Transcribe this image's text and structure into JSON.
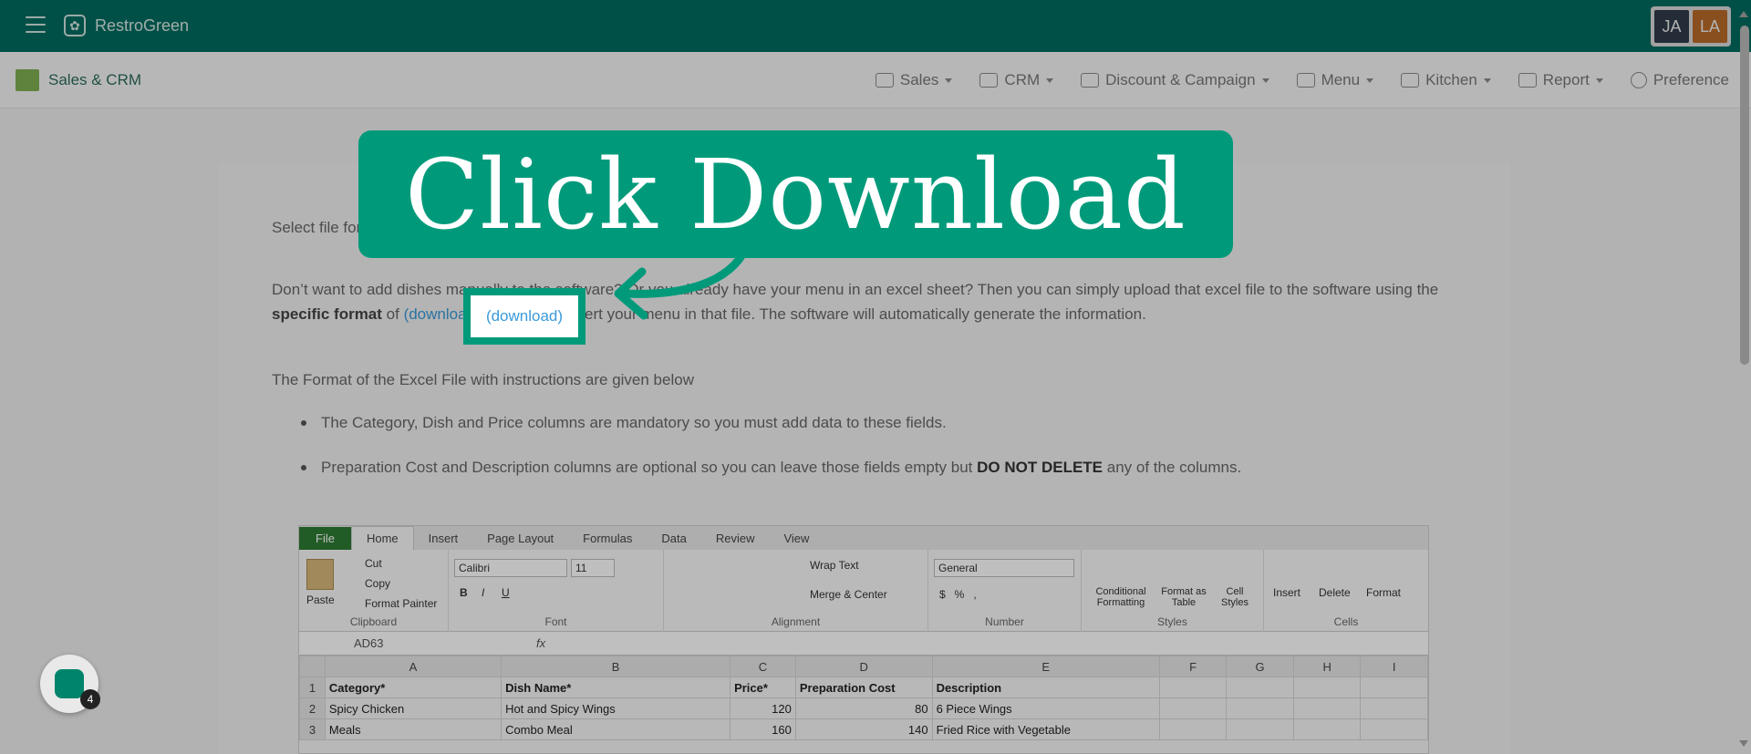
{
  "topbar": {
    "brand": "RestroGreen",
    "avatars": [
      {
        "initials": "JA",
        "color": "#2f3b4a"
      },
      {
        "initials": "LA",
        "color": "#b86a28"
      }
    ]
  },
  "navbar": {
    "module": "Sales & CRM",
    "items": [
      {
        "label": "Sales",
        "icon": "register-icon"
      },
      {
        "label": "CRM",
        "icon": "users-icon"
      },
      {
        "label": "Discount & Campaign",
        "icon": "megaphone-icon"
      },
      {
        "label": "Menu",
        "icon": "menu-list-icon"
      },
      {
        "label": "Kitchen",
        "icon": "chef-hat-icon"
      },
      {
        "label": "Report",
        "icon": "report-icon"
      },
      {
        "label": "Preference",
        "icon": "gear-icon"
      }
    ]
  },
  "content": {
    "para1": "Select file for",
    "para2_part1": "Don’t want to add dishes manually to the software? Or you already have your menu in an excel sheet? Then you can simply upload that excel file to the software using the ",
    "para2_bold": "specific format",
    "para2_part2": " of ",
    "para2_link": "(download)",
    "para2_part3": " the file and insert your menu in that file. The software will automatically generate the information.",
    "para3": "The Format of the Excel File with instructions are given below",
    "bullet1": "The Category, Dish and Price columns are mandatory so you must add data to these fields.",
    "bullet2_part1": "Preparation Cost and Description columns are optional so you can leave those fields empty but ",
    "bullet2_bold": "DO NOT DELETE",
    "bullet2_part2": " any of the columns."
  },
  "callout": {
    "text": "Click Download",
    "color": "#009a7b"
  },
  "download_link": "(download)",
  "excel": {
    "tabs": [
      "File",
      "Home",
      "Insert",
      "Page Layout",
      "Formulas",
      "Data",
      "Review",
      "View"
    ],
    "clipboard": {
      "paste": "Paste",
      "cut": "Cut",
      "copy": "Copy",
      "format_painter": "Format Painter",
      "label": "Clipboard"
    },
    "font": {
      "name": "Calibri",
      "size": "11",
      "label": "Font"
    },
    "alignment": {
      "wrap": "Wrap Text",
      "merge": "Merge & Center",
      "label": "Alignment"
    },
    "number": {
      "format": "General",
      "label": "Number"
    },
    "styles": {
      "cond": "Conditional Formatting",
      "table": "Format as Table",
      "cell": "Cell Styles",
      "label": "Styles"
    },
    "cells": {
      "insert": "Insert",
      "delete": "Delete",
      "format": "Format",
      "label": "Cells"
    },
    "name_box": "AD63",
    "fx": "fx",
    "columns": [
      "A",
      "B",
      "C",
      "D",
      "E",
      "F",
      "G",
      "H",
      "I"
    ],
    "rows": [
      {
        "n": "1",
        "a": "Category*",
        "b": "Dish Name*",
        "c": "Price*",
        "d": "Preparation Cost",
        "e": "Description",
        "header": true
      },
      {
        "n": "2",
        "a": "Spicy Chicken",
        "b": "Hot and Spicy Wings",
        "c": "120",
        "d": "80",
        "e": "6 Piece Wings"
      },
      {
        "n": "3",
        "a": "Meals",
        "b": "Combo Meal",
        "c": "160",
        "d": "140",
        "e": "Fried Rice with Vegetable"
      }
    ]
  },
  "chat": {
    "badge": "4"
  }
}
